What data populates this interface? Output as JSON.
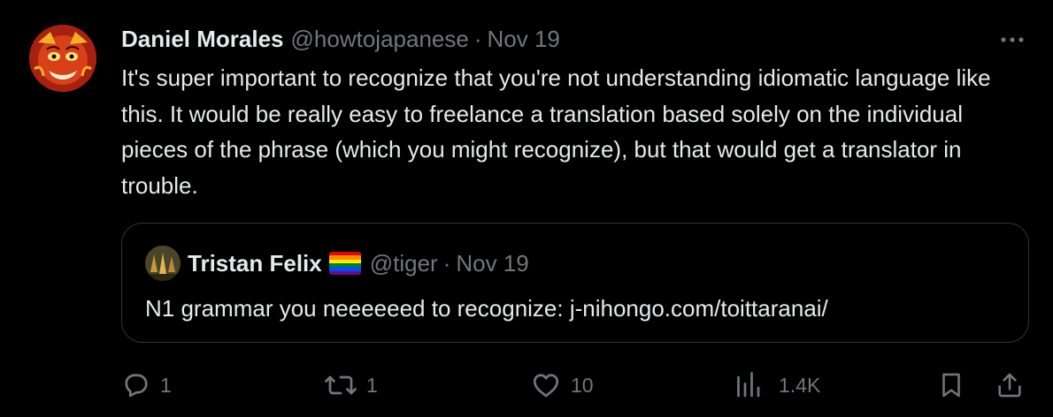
{
  "tweet": {
    "author_name": "Daniel Morales",
    "author_handle": "@howtojapanese",
    "separator": "·",
    "date": "Nov 19",
    "text": "It's super important to recognize that you're not understanding idiomatic language like this. It would be really easy to freelance a translation based solely on the individual pieces of the phrase (which you might recognize), but that would get a translator in trouble."
  },
  "quoted_tweet": {
    "author_name": "Tristan Felix",
    "author_handle": "@tiger",
    "separator": "·",
    "date": "Nov 19",
    "text": "N1 grammar you neeeeeed to recognize: j-nihongo.com/toittaranai/"
  },
  "actions": {
    "reply_count": "1",
    "retweet_count": "1",
    "like_count": "10",
    "views_count": "1.4K"
  },
  "icons": {
    "more": "more-dots-icon",
    "reply": "reply-bubble-icon",
    "retweet": "retweet-icon",
    "like": "heart-icon",
    "views": "views-chart-icon",
    "bookmark": "bookmark-icon",
    "share": "share-icon"
  },
  "colors": {
    "background": "#000000",
    "text_primary": "#e7e9ea",
    "text_secondary": "#71767b",
    "border": "#2f3336"
  }
}
